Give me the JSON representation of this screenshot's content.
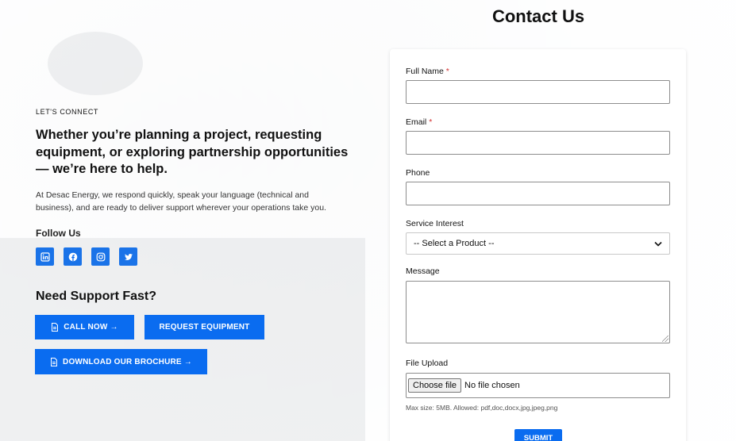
{
  "page": {
    "title": "Contact Us"
  },
  "left": {
    "eyebrow": "LET'S CONNECT",
    "headline": "Whether you’re planning a project, requesting equipment, or exploring partnership opportunities — we’re here to help.",
    "description": "At Desac Energy, we respond quickly, speak your language (technical and business), and are ready to deliver support wherever your operations take you.",
    "follow_label": "Follow Us",
    "socials": [
      {
        "icon": "linkedin-icon"
      },
      {
        "icon": "facebook-icon"
      },
      {
        "icon": "instagram-icon"
      },
      {
        "icon": "twitter-icon"
      }
    ],
    "support_title": "Need Support Fast?",
    "buttons": {
      "call": "CALL NOW →",
      "request": "REQUEST EQUIPMENT",
      "brochure": "DOWNLOAD OUR BROCHURE →"
    }
  },
  "form": {
    "full_name_label": "Full Name",
    "email_label": "Email",
    "required_mark": "*",
    "phone_label": "Phone",
    "service_label": "Service Interest",
    "service_selected": "-- Select a Product --",
    "message_label": "Message",
    "file_label": "File Upload",
    "choose_file": "Choose file",
    "no_file": "No file chosen",
    "file_hint": "Max size: 5MB. Allowed: pdf,doc,docx,jpg,jpeg,png",
    "submit": "SUBMIT"
  },
  "colors": {
    "accent": "#0a6cf0",
    "required": "#d32f2f"
  }
}
